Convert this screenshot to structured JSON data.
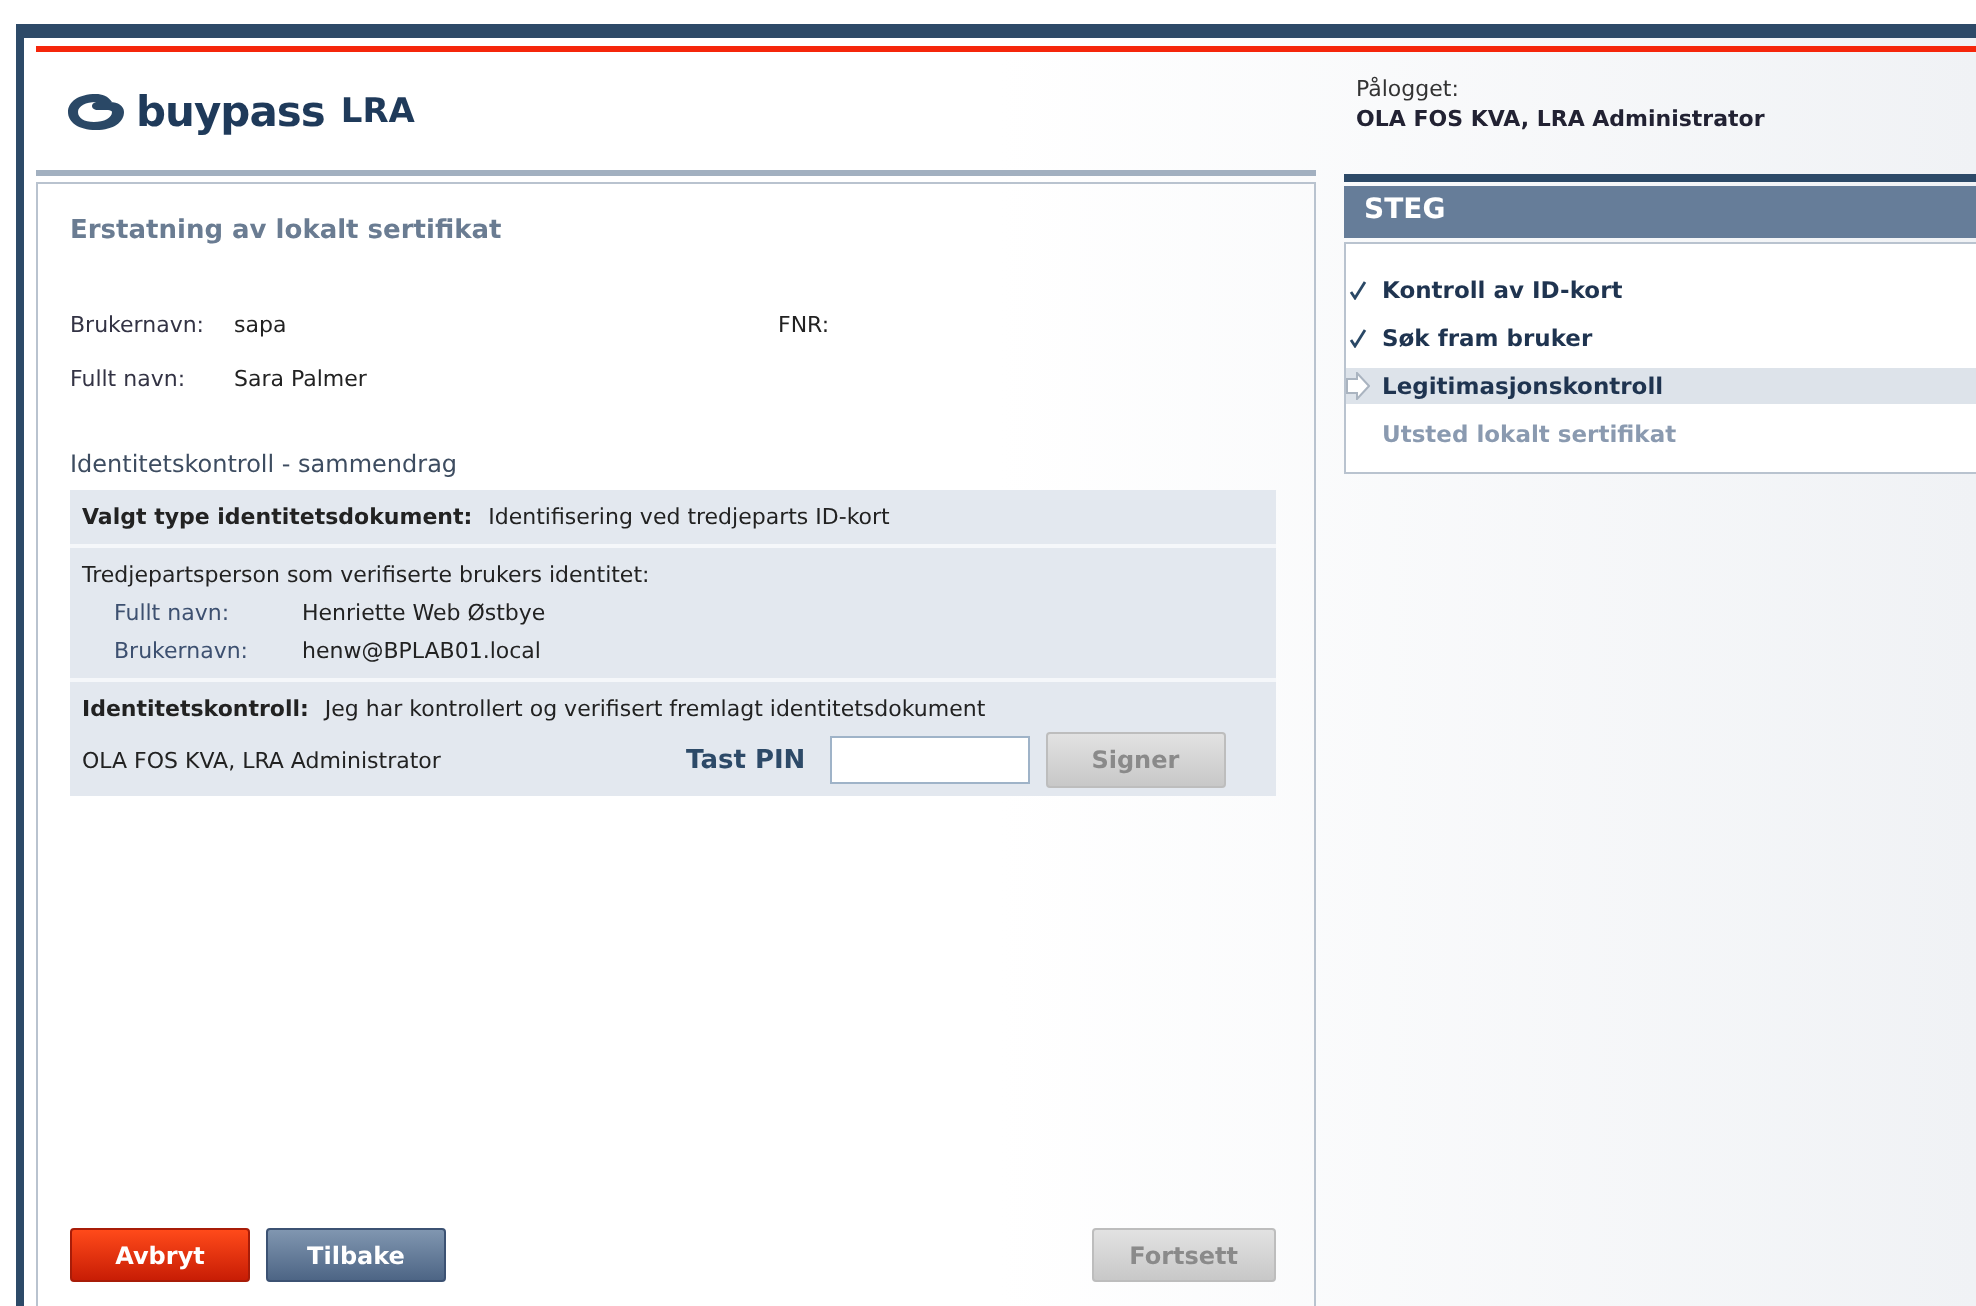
{
  "logo": {
    "brand": "buypass",
    "suffix": "LRA"
  },
  "page_title": "Erstatning av lokalt sertifikat",
  "user": {
    "username_label": "Brukernavn:",
    "username": "sapa",
    "fnr_label": "FNR:",
    "fullname_label": "Fullt navn:",
    "fullname": "Sara Palmer"
  },
  "summary": {
    "heading": "Identitetskontroll - sammendrag",
    "doc_type_label": "Valgt type identitetsdokument:",
    "doc_type": "Identifisering ved tredjeparts ID-kort",
    "third_party_heading": "Tredjepartsperson som verifiserte brukers identitet:",
    "third_party": [
      {
        "label": "Fullt navn:",
        "value": "Henriette Web Østbye"
      },
      {
        "label": "Brukernavn:",
        "value": "henw@BPLAB01.local"
      }
    ],
    "control_label": "Identitetskontroll:",
    "control_text": "Jeg har kontrollert og verifisert fremlagt identitetsdokument",
    "signer": "OLA FOS KVA,  LRA Administrator",
    "pin_label": "Tast PIN",
    "sign_button": {
      "label": "Signer",
      "disabled": true
    }
  },
  "buttons": [
    {
      "label": "Avbryt",
      "kind": "cancel",
      "disabled": false
    },
    {
      "label": "Tilbake",
      "kind": "back",
      "disabled": false
    },
    {
      "label": "Fortsett",
      "kind": "next",
      "disabled": true
    }
  ],
  "login": {
    "label": "Pålogget:",
    "name": "OLA FOS KVA,  LRA Administrator"
  },
  "steps": {
    "title": "STEG",
    "items": [
      {
        "label": "Kontroll av ID-kort",
        "done": true,
        "selected": false
      },
      {
        "label": "Søk fram bruker",
        "done": true,
        "selected": false
      },
      {
        "label": "Legitimasjonskontroll",
        "done": false,
        "selected": true
      },
      {
        "label": "Utsted lokalt sertifikat",
        "done": false,
        "selected": false
      }
    ]
  }
}
